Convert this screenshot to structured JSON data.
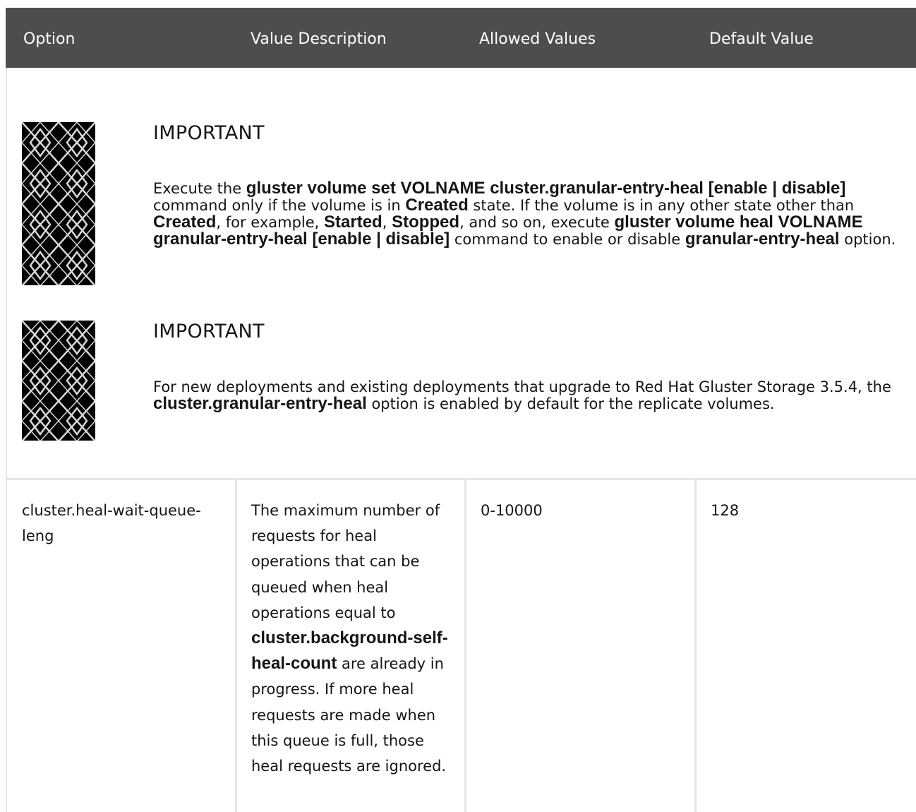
{
  "table": {
    "headers": [
      "Option",
      "Value Description",
      "Allowed Values",
      "Default Value"
    ]
  },
  "notes": [
    {
      "title": "IMPORTANT",
      "icon": "important-pattern-icon",
      "body": [
        {
          "text": "Execute the ",
          "bold": false
        },
        {
          "text": "gluster volume set VOLNAME cluster.granular-entry-heal [enable | disable]",
          "bold": true
        },
        {
          "text": " command only if the volume is in ",
          "bold": false
        },
        {
          "text": "Created",
          "bold": true
        },
        {
          "text": " state. If the volume is in any other state other than ",
          "bold": false
        },
        {
          "text": "Created",
          "bold": true
        },
        {
          "text": ", for example, ",
          "bold": false
        },
        {
          "text": "Started",
          "bold": true
        },
        {
          "text": ", ",
          "bold": false
        },
        {
          "text": "Stopped",
          "bold": true
        },
        {
          "text": ", and so on, execute ",
          "bold": false
        },
        {
          "text": "gluster volume heal VOLNAME granular-entry-heal [enable | disable]",
          "bold": true
        },
        {
          "text": " command to enable or disable ",
          "bold": false
        },
        {
          "text": "granular-entry-heal",
          "bold": true
        },
        {
          "text": " option.",
          "bold": false
        }
      ]
    },
    {
      "title": "IMPORTANT",
      "icon": "important-pattern-icon",
      "body": [
        {
          "text": "For new deployments and existing deployments that upgrade to Red Hat Gluster Storage 3.5.4, the ",
          "bold": false
        },
        {
          "text": "cluster.granular-entry-heal",
          "bold": true
        },
        {
          "text": " option is enabled by default for the replicate volumes.",
          "bold": false
        }
      ]
    }
  ],
  "row": {
    "option": "cluster.heal-wait-queue-leng",
    "description": [
      {
        "text": "The maximum number of requests for heal operations that can be queued when heal operations equal to ",
        "bold": false
      },
      {
        "text": "cluster.background-self-heal-count",
        "bold": true
      },
      {
        "text": " are already in progress. If more heal requests are made when this queue is full, those heal requests are ignored.",
        "bold": false
      }
    ],
    "allowed": "0-10000",
    "default": "128"
  }
}
